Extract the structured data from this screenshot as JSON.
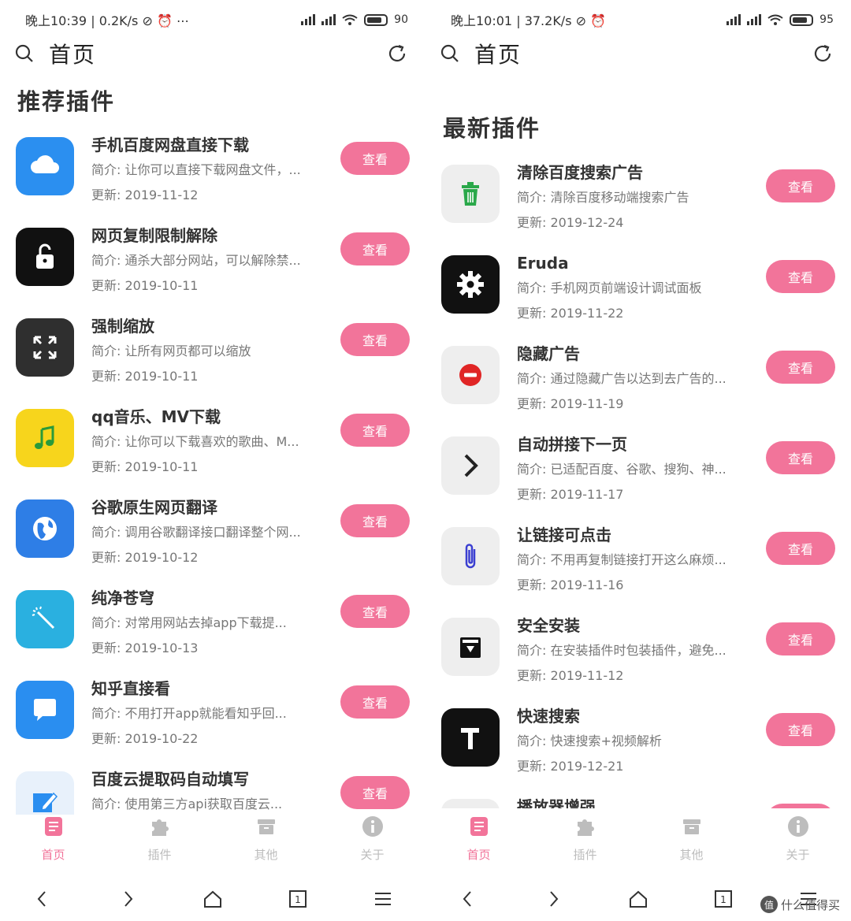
{
  "left": {
    "status": {
      "time": "晚上10:39",
      "speed": "0.2K/s",
      "extra": "⊘ ⏰ ⋯",
      "battery": "90"
    },
    "topbar": {
      "title": "首页"
    },
    "section_title": "推荐插件",
    "items": [
      {
        "name": "手机百度网盘直接下载",
        "desc": "简介: 让你可以直接下载网盘文件，...",
        "date": "更新: 2019-11-12",
        "button": "查看",
        "icon": "cloud-icon",
        "icon_bg": "#2b8ff0"
      },
      {
        "name": "网页复制限制解除",
        "desc": "简介: 通杀大部分网站，可以解除禁...",
        "date": "更新: 2019-10-11",
        "button": "查看",
        "icon": "unlock-icon",
        "icon_bg": "#111111"
      },
      {
        "name": "强制缩放",
        "desc": "简介: 让所有网页都可以缩放",
        "date": "更新: 2019-10-11",
        "button": "查看",
        "icon": "expand-icon",
        "icon_bg": "#2f2f2f"
      },
      {
        "name": "qq音乐、MV下载",
        "desc": "简介: 让你可以下载喜欢的歌曲、M...",
        "date": "更新: 2019-10-11",
        "button": "查看",
        "icon": "music-note-icon",
        "icon_bg": "#f7d51c"
      },
      {
        "name": "谷歌原生网页翻译",
        "desc": "简介: 调用谷歌翻译接口翻译整个网...",
        "date": "更新: 2019-10-12",
        "button": "查看",
        "icon": "globe-icon",
        "icon_bg": "#2e7ee6"
      },
      {
        "name": "纯净苍穹",
        "desc": "简介: 对常用网站去掉app下载提...",
        "date": "更新: 2019-10-13",
        "button": "查看",
        "icon": "magic-wand-icon",
        "icon_bg": "#2ab0e0"
      },
      {
        "name": "知乎直接看",
        "desc": "简介: 不用打开app就能看知乎回...",
        "date": "更新: 2019-10-22",
        "button": "查看",
        "icon": "chat-bubble-icon",
        "icon_bg": "#2a8ef0"
      },
      {
        "name": "百度云提取码自动填写",
        "desc": "简介: 使用第三方api获取百度云...",
        "date": "",
        "button": "查看",
        "icon": "edit-icon",
        "icon_bg": "#e8f1fb"
      }
    ],
    "tabs": [
      {
        "label": "首页",
        "icon": "home-doc-icon",
        "active": true
      },
      {
        "label": "插件",
        "icon": "puzzle-icon",
        "active": false
      },
      {
        "label": "其他",
        "icon": "box-icon",
        "active": false
      },
      {
        "label": "关于",
        "icon": "info-icon",
        "active": false
      }
    ]
  },
  "right": {
    "status": {
      "time": "晚上10:01",
      "speed": "37.2K/s",
      "extra": "⊘ ⏰",
      "battery": "95"
    },
    "topbar": {
      "title": "首页"
    },
    "section_title": "最新插件",
    "items": [
      {
        "name": "清除百度搜索广告",
        "desc": "简介: 清除百度移动端搜索广告",
        "date": "更新: 2019-12-24",
        "button": "查看",
        "icon": "trash-icon",
        "icon_bg": "#eeeeee"
      },
      {
        "name": "Eruda",
        "desc": "简介: 手机网页前端设计调试面板",
        "date": "更新: 2019-11-22",
        "button": "查看",
        "icon": "gear-icon",
        "icon_bg": "#111111"
      },
      {
        "name": "隐藏广告",
        "desc": "简介: 通过隐藏广告以达到去广告的...",
        "date": "更新: 2019-11-19",
        "button": "查看",
        "icon": "no-entry-icon",
        "icon_bg": "#eeeeee"
      },
      {
        "name": "自动拼接下一页",
        "desc": "简介: 已适配百度、谷歌、搜狗、神...",
        "date": "更新: 2019-11-17",
        "button": "查看",
        "icon": "chevron-right-icon",
        "icon_bg": "#eeeeee"
      },
      {
        "name": "让链接可点击",
        "desc": "简介: 不用再复制链接打开这么麻烦...",
        "date": "更新: 2019-11-16",
        "button": "查看",
        "icon": "paperclip-icon",
        "icon_bg": "#eeeeee"
      },
      {
        "name": "安全安装",
        "desc": "简介: 在安装插件时包装插件，避免...",
        "date": "更新: 2019-11-12",
        "button": "查看",
        "icon": "archive-icon",
        "icon_bg": "#eeeeee"
      },
      {
        "name": "快速搜索",
        "desc": "简介: 快速搜索+视频解析",
        "date": "更新: 2019-12-21",
        "button": "查看",
        "icon": "hammer-icon",
        "icon_bg": "#111111"
      },
      {
        "name": "播放器增强",
        "desc": "",
        "date": "",
        "button": "查看",
        "icon": "player-icon",
        "icon_bg": "#eeeeee"
      }
    ],
    "tabs": [
      {
        "label": "首页",
        "icon": "home-doc-icon",
        "active": true
      },
      {
        "label": "插件",
        "icon": "puzzle-icon",
        "active": false
      },
      {
        "label": "其他",
        "icon": "box-icon",
        "active": false
      },
      {
        "label": "关于",
        "icon": "info-icon",
        "active": false
      }
    ]
  },
  "watermark": {
    "text": "什么值得买",
    "badge": "值"
  },
  "colors": {
    "accent": "#f2749a",
    "inactive": "#bdbdbd"
  }
}
